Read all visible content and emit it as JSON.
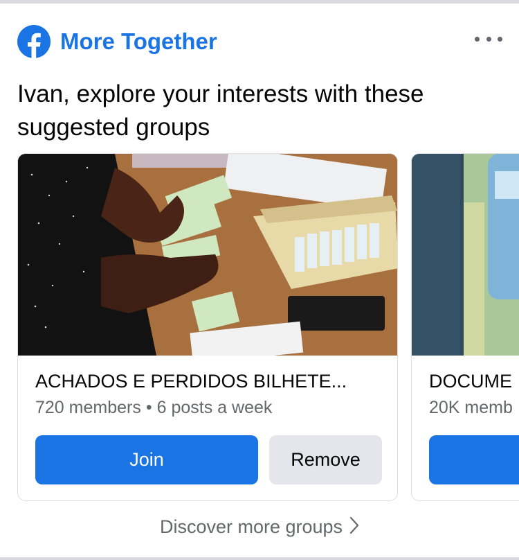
{
  "header": {
    "title": "More Together",
    "logo_icon": "facebook-logo-icon",
    "more_icon": "more-horizontal-icon"
  },
  "subtitle": "Ivan, explore your interests with these suggested groups",
  "groups": [
    {
      "name": "ACHADOS E PERDIDOS BILHETE...",
      "members": "720 members",
      "frequency": "6 posts a week",
      "join_label": "Join",
      "remove_label": "Remove"
    },
    {
      "name": "DOCUME",
      "members": "20K memb",
      "join_label": ""
    }
  ],
  "footer": {
    "discover_label": "Discover more groups",
    "chevron_icon": "chevron-right-icon"
  },
  "colors": {
    "brand_blue": "#1b74e4",
    "secondary_text": "#65676b",
    "remove_bg": "#e4e6eb"
  }
}
